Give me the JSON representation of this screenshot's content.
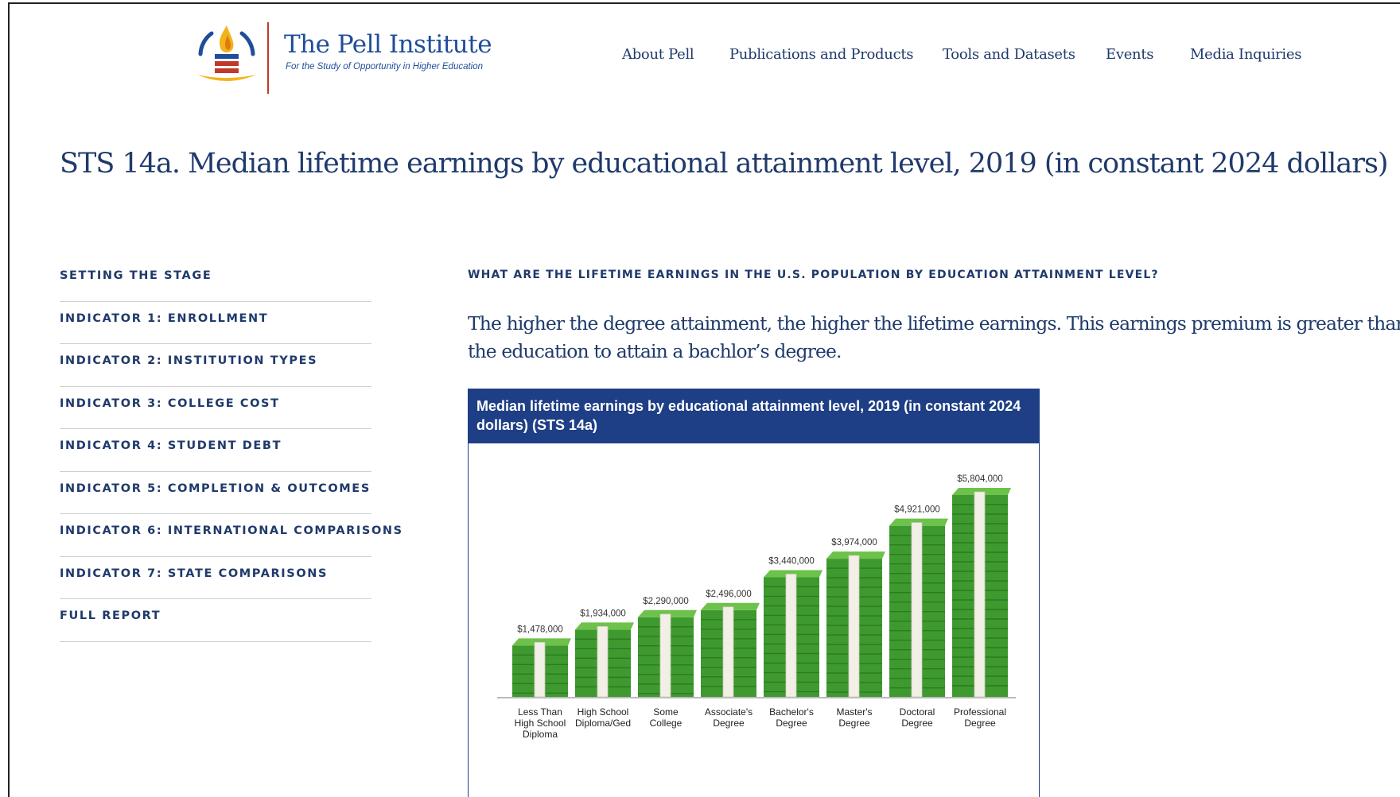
{
  "header": {
    "logo": {
      "name": "The Pell Institute",
      "tagline": "For the Study of Opportunity in Higher Education"
    },
    "nav": [
      {
        "label": "About Pell"
      },
      {
        "label": "Publications and Products"
      },
      {
        "label": "Tools and Datasets"
      },
      {
        "label": "Events"
      },
      {
        "label": "Media Inquiries"
      }
    ]
  },
  "page": {
    "title": "STS 14a. Median lifetime earnings by educational attainment level, 2019 (in constant 2024 dollars)"
  },
  "sidebar": {
    "items": [
      {
        "label": "SETTING THE STAGE"
      },
      {
        "label": "INDICATOR 1: ENROLLMENT"
      },
      {
        "label": "INDICATOR 2: INSTITUTION TYPES"
      },
      {
        "label": "INDICATOR 3: COLLEGE COST"
      },
      {
        "label": "INDICATOR 4: STUDENT DEBT"
      },
      {
        "label": "INDICATOR 5: COMPLETION & OUTCOMES"
      },
      {
        "label": "INDICATOR 6: INTERNATIONAL COMPARISONS"
      },
      {
        "label": "INDICATOR 7: STATE COMPARISONS"
      },
      {
        "label": "FULL REPORT"
      }
    ]
  },
  "main": {
    "question": "WHAT ARE THE LIFETIME EARNINGS IN THE U.S. POPULATION BY EDUCATION ATTAINMENT LEVEL?",
    "summary_line1": "The higher the degree attainment, the higher the lifetime earnings. This earnings premium is greater than cost",
    "summary_line2": "the education to attain a bachlor’s degree."
  },
  "colors": {
    "brand_navy": "#1f3a6b",
    "chart_header": "#1e3f86",
    "money_green": "#3e9a2f",
    "logo_red": "#c0392b",
    "logo_gold": "#f2b41c"
  },
  "chart_data": {
    "type": "bar",
    "title": "Median lifetime earnings by educational attainment level, 2019 (in constant 2024 dollars) (STS 14a)",
    "categories": [
      [
        "Less Than",
        "High School",
        "Diploma"
      ],
      [
        "High School",
        "Diploma/Ged"
      ],
      [
        "Some",
        "College"
      ],
      [
        "Associate's",
        "Degree"
      ],
      [
        "Bachelor's",
        "Degree"
      ],
      [
        "Master's",
        "Degree"
      ],
      [
        "Doctoral",
        "Degree"
      ],
      [
        "Professional",
        "Degree"
      ]
    ],
    "values": [
      1478000,
      1934000,
      2290000,
      2496000,
      3440000,
      3974000,
      4921000,
      5804000
    ],
    "value_labels": [
      "$1,478,000",
      "$1,934,000",
      "$2,290,000",
      "$2,496,000",
      "$3,440,000",
      "$3,974,000",
      "$4,921,000",
      "$5,804,000"
    ],
    "xlabel": "",
    "ylabel": "",
    "ylim": [
      0,
      6000000
    ],
    "grid": false,
    "legend": "none"
  }
}
